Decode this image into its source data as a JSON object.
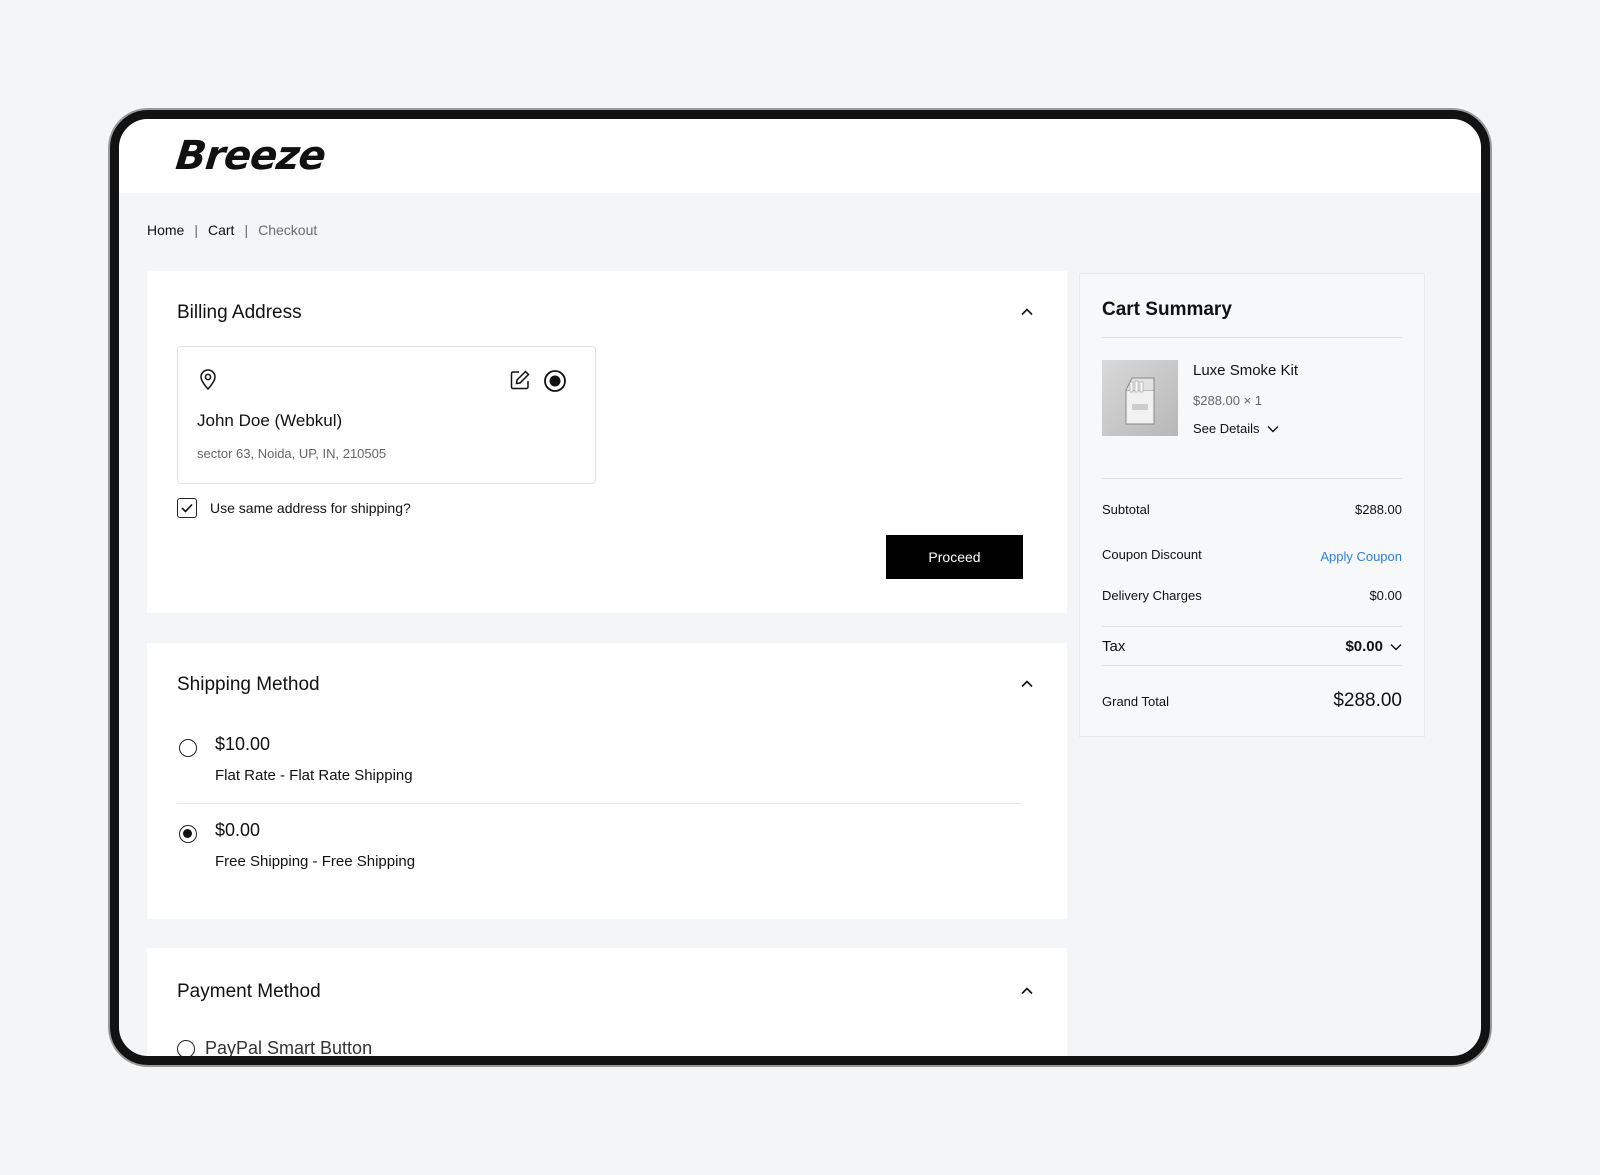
{
  "brand": {
    "logo": "Breeze"
  },
  "breadcrumb": {
    "items": [
      "Home",
      "Cart"
    ],
    "separator": "|",
    "current": "Checkout"
  },
  "billing": {
    "title": "Billing Address",
    "address": {
      "name": "John Doe (Webkul)",
      "line": "sector 63, Noida, UP, IN, 210505"
    },
    "same_address_label": "Use same address for shipping?",
    "same_address_checked": true,
    "proceed_label": "Proceed"
  },
  "shipping": {
    "title": "Shipping Method",
    "options": [
      {
        "price": "$10.00",
        "label": "Flat Rate - Flat Rate Shipping",
        "selected": false
      },
      {
        "price": "$0.00",
        "label": "Free Shipping - Free Shipping",
        "selected": true
      }
    ]
  },
  "payment": {
    "title": "Payment Method",
    "first_option": "PayPal Smart Button"
  },
  "cart_summary": {
    "title": "Cart Summary",
    "item": {
      "name": "Luxe Smoke Kit",
      "price_qty": "$288.00 × 1",
      "details_label": "See Details"
    },
    "subtotal_label": "Subtotal",
    "subtotal_value": "$288.00",
    "coupon_label": "Coupon Discount",
    "coupon_action": "Apply Coupon",
    "delivery_label": "Delivery Charges",
    "delivery_value": "$0.00",
    "tax_label": "Tax",
    "tax_value": "$0.00",
    "grand_total_label": "Grand Total",
    "grand_total_value": "$288.00"
  },
  "colors": {
    "accent_link": "#2f7de1",
    "button_bg": "#000000",
    "page_bg": "#f4f5f7"
  }
}
